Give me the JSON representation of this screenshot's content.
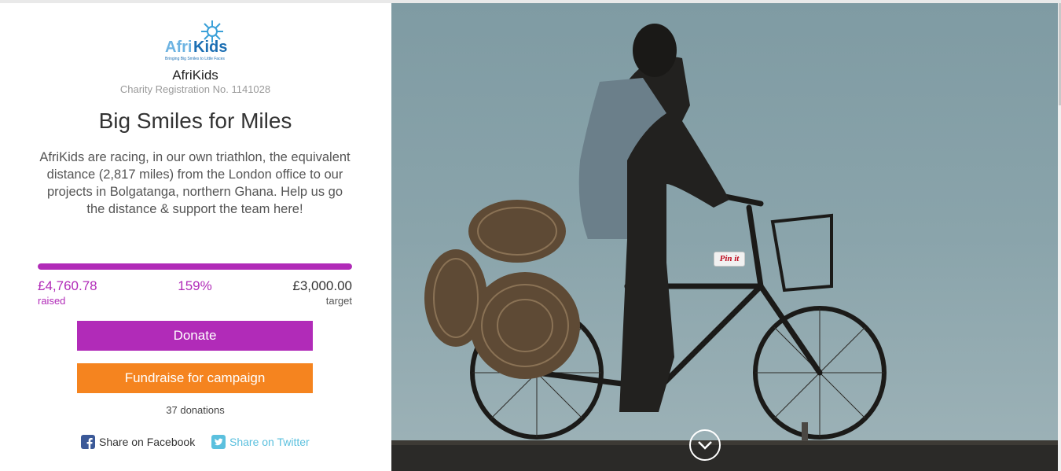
{
  "charity": {
    "logo_text_afri": "Afri",
    "logo_text_kids": "Kids",
    "logo_tagline": "Bringing Big Smiles to Little Faces",
    "name": "AfriKids",
    "registration": "Charity Registration No. 1141028"
  },
  "campaign": {
    "title": "Big Smiles for Miles",
    "description": "AfriKids are racing, in our own triathlon, the equivalent distance (2,817 miles) from the London office to our projects in Bolgatanga, northern Ghana. Help us go the distance & support the team here!"
  },
  "progress": {
    "raised_amount": "£4,760.78",
    "raised_label": "raised",
    "percent_label": "159%",
    "fill_fraction": 1.0,
    "target_amount": "£3,000.00",
    "target_label": "target"
  },
  "actions": {
    "donate_label": "Donate",
    "fundraise_label": "Fundraise for campaign"
  },
  "donations_count": "37 donations",
  "share": {
    "facebook_label": "Share on Facebook",
    "twitter_label": "Share on Twitter"
  },
  "hero": {
    "pinit_label": "Pin it"
  },
  "colors": {
    "accent_purple": "#b12bb8",
    "accent_orange": "#f5841f",
    "facebook_blue": "#3b5998",
    "twitter_blue": "#5bc0de"
  },
  "icons": {
    "facebook": "facebook-icon",
    "twitter": "twitter-icon",
    "scroll_down": "chevron-down-icon",
    "logo_sun": "sun-icon"
  }
}
